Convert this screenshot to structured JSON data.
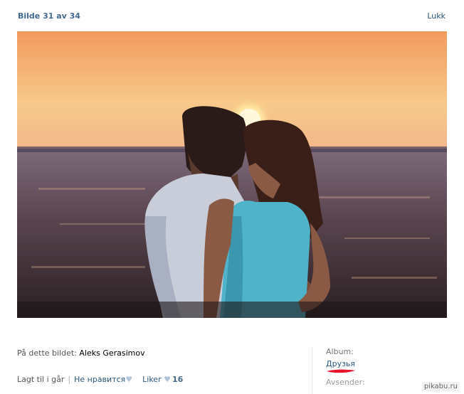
{
  "header": {
    "title": "Bilde 31 av 34",
    "close_label": "Lukk"
  },
  "photo": {
    "alt": ""
  },
  "tagged": {
    "prefix": "På dette bildet: ",
    "name": "Aleks Gerasimov"
  },
  "actions": {
    "added": "Lagt til i går",
    "dislike": "Не нравится",
    "like": "Liker",
    "like_count": "16"
  },
  "album": {
    "label": "Album:",
    "name": "Друзья"
  },
  "sender": {
    "label": "Avsender:"
  },
  "watermark": "pikabu.ru",
  "colors": {
    "link": "#2b587a",
    "title": "#45688e",
    "heart": "#b3c5d8",
    "underline_mark": "#e8132a"
  },
  "icons": {
    "heart": "heart-icon"
  }
}
